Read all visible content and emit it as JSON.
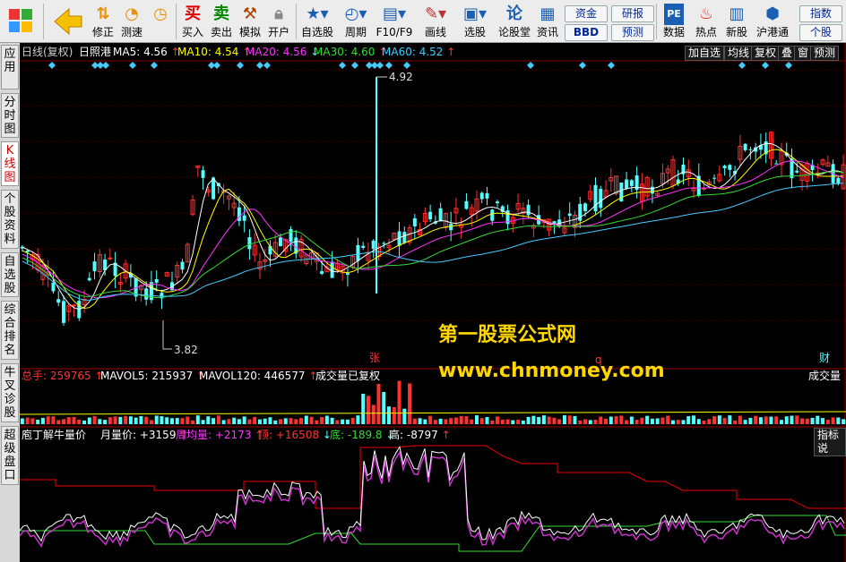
{
  "toolbar": {
    "items": [
      {
        "label": "",
        "icon": "windows-icon"
      },
      {
        "label": "",
        "icon": "back-arrow-icon"
      },
      {
        "label": "修正",
        "icon": "refresh-icon"
      },
      {
        "label": "测速",
        "icon": "clock-icon"
      },
      {
        "label": "买入",
        "icon": "buy-icon",
        "glyph": "买"
      },
      {
        "label": "卖出",
        "icon": "sell-icon",
        "glyph": "卖"
      },
      {
        "label": "模拟",
        "icon": "hammer-icon"
      },
      {
        "label": "开户",
        "icon": "lock-icon"
      },
      {
        "label": "自选股",
        "icon": "star-icon"
      },
      {
        "label": "周期",
        "icon": "cycle-icon"
      },
      {
        "label": "F10/F9",
        "icon": "f10-icon"
      },
      {
        "label": "画线",
        "icon": "pencil-icon"
      },
      {
        "label": "选股",
        "icon": "monitor-icon"
      },
      {
        "label": "论股堂",
        "icon": "forum-icon",
        "glyph": "论"
      },
      {
        "label": "资讯",
        "icon": "news-icon"
      },
      {
        "label": "数据",
        "icon": "pe-icon",
        "glyph": "PE"
      },
      {
        "label": "热点",
        "icon": "hot-icon"
      },
      {
        "label": "新股",
        "icon": "ipo-icon"
      },
      {
        "label": "沪港通",
        "icon": "hk-connect-icon"
      }
    ],
    "pills": {
      "zijin": "资金",
      "bbd": "BBD",
      "yanbao": "研报",
      "yuce": "预测",
      "zhishu": "指数",
      "gegu": "个股"
    }
  },
  "sidebar": {
    "tabs": [
      {
        "label": "应用"
      },
      {
        "label": "分时图"
      },
      {
        "label": "K线图",
        "active": true
      },
      {
        "label": "个股资料"
      },
      {
        "label": "自选股"
      },
      {
        "label": "综合排名"
      },
      {
        "label": "牛叉诊股"
      },
      {
        "label": "超级盘口"
      }
    ]
  },
  "header": {
    "mode": "日线(复权)",
    "stock": "日照港",
    "ma": [
      {
        "label": "MA5:",
        "value": "4.56",
        "dir": "↑",
        "color": "#ffffff"
      },
      {
        "label": "MA10:",
        "value": "4.54",
        "dir": "↑",
        "color": "#ffff00"
      },
      {
        "label": "MA20:",
        "value": "4.56",
        "dir": "↓",
        "color": "#ff33ff"
      },
      {
        "label": "MA30:",
        "value": "4.60",
        "dir": "↑",
        "color": "#33dd33"
      },
      {
        "label": "MA60:",
        "value": "4.52",
        "dir": "↑",
        "color": "#44ccff"
      }
    ],
    "buttons": [
      "加自选",
      "均线",
      "复权",
      "叠",
      "窗",
      "预测"
    ]
  },
  "price": {
    "high": "4.92",
    "low": "3.82",
    "zhang": "张",
    "q": "q",
    "cai": "财"
  },
  "watermark": {
    "line1": "第一股票公式网",
    "line2": "www.chnmoney.com"
  },
  "volume": {
    "zongshou": "总手: 259765",
    "zongshou_dir": "↑",
    "mavol5": "MAVOL5: 215937",
    "mavol5_dir": "↑",
    "mavol120": "MAVOL120: 446577",
    "mavol120_dir": "↑",
    "note": "成交量已复权",
    "label": "成交量"
  },
  "indicator": {
    "name": "庖丁解牛量价",
    "yueliang": "月量价: +3159",
    "yueliang_dir": "↑",
    "zhouliang": "周均量: +2173",
    "zhouliang_dir": "↑",
    "ding": "顶: +16508",
    "ding_dir": "↓",
    "di": "底: -189.8",
    "di_dir": "↓",
    "gao": "高: -8797",
    "gao_dir": "↑",
    "btn": "指标说"
  },
  "colors": {
    "up": "#ff3232",
    "down": "#54ffff",
    "grid": "#800000"
  }
}
